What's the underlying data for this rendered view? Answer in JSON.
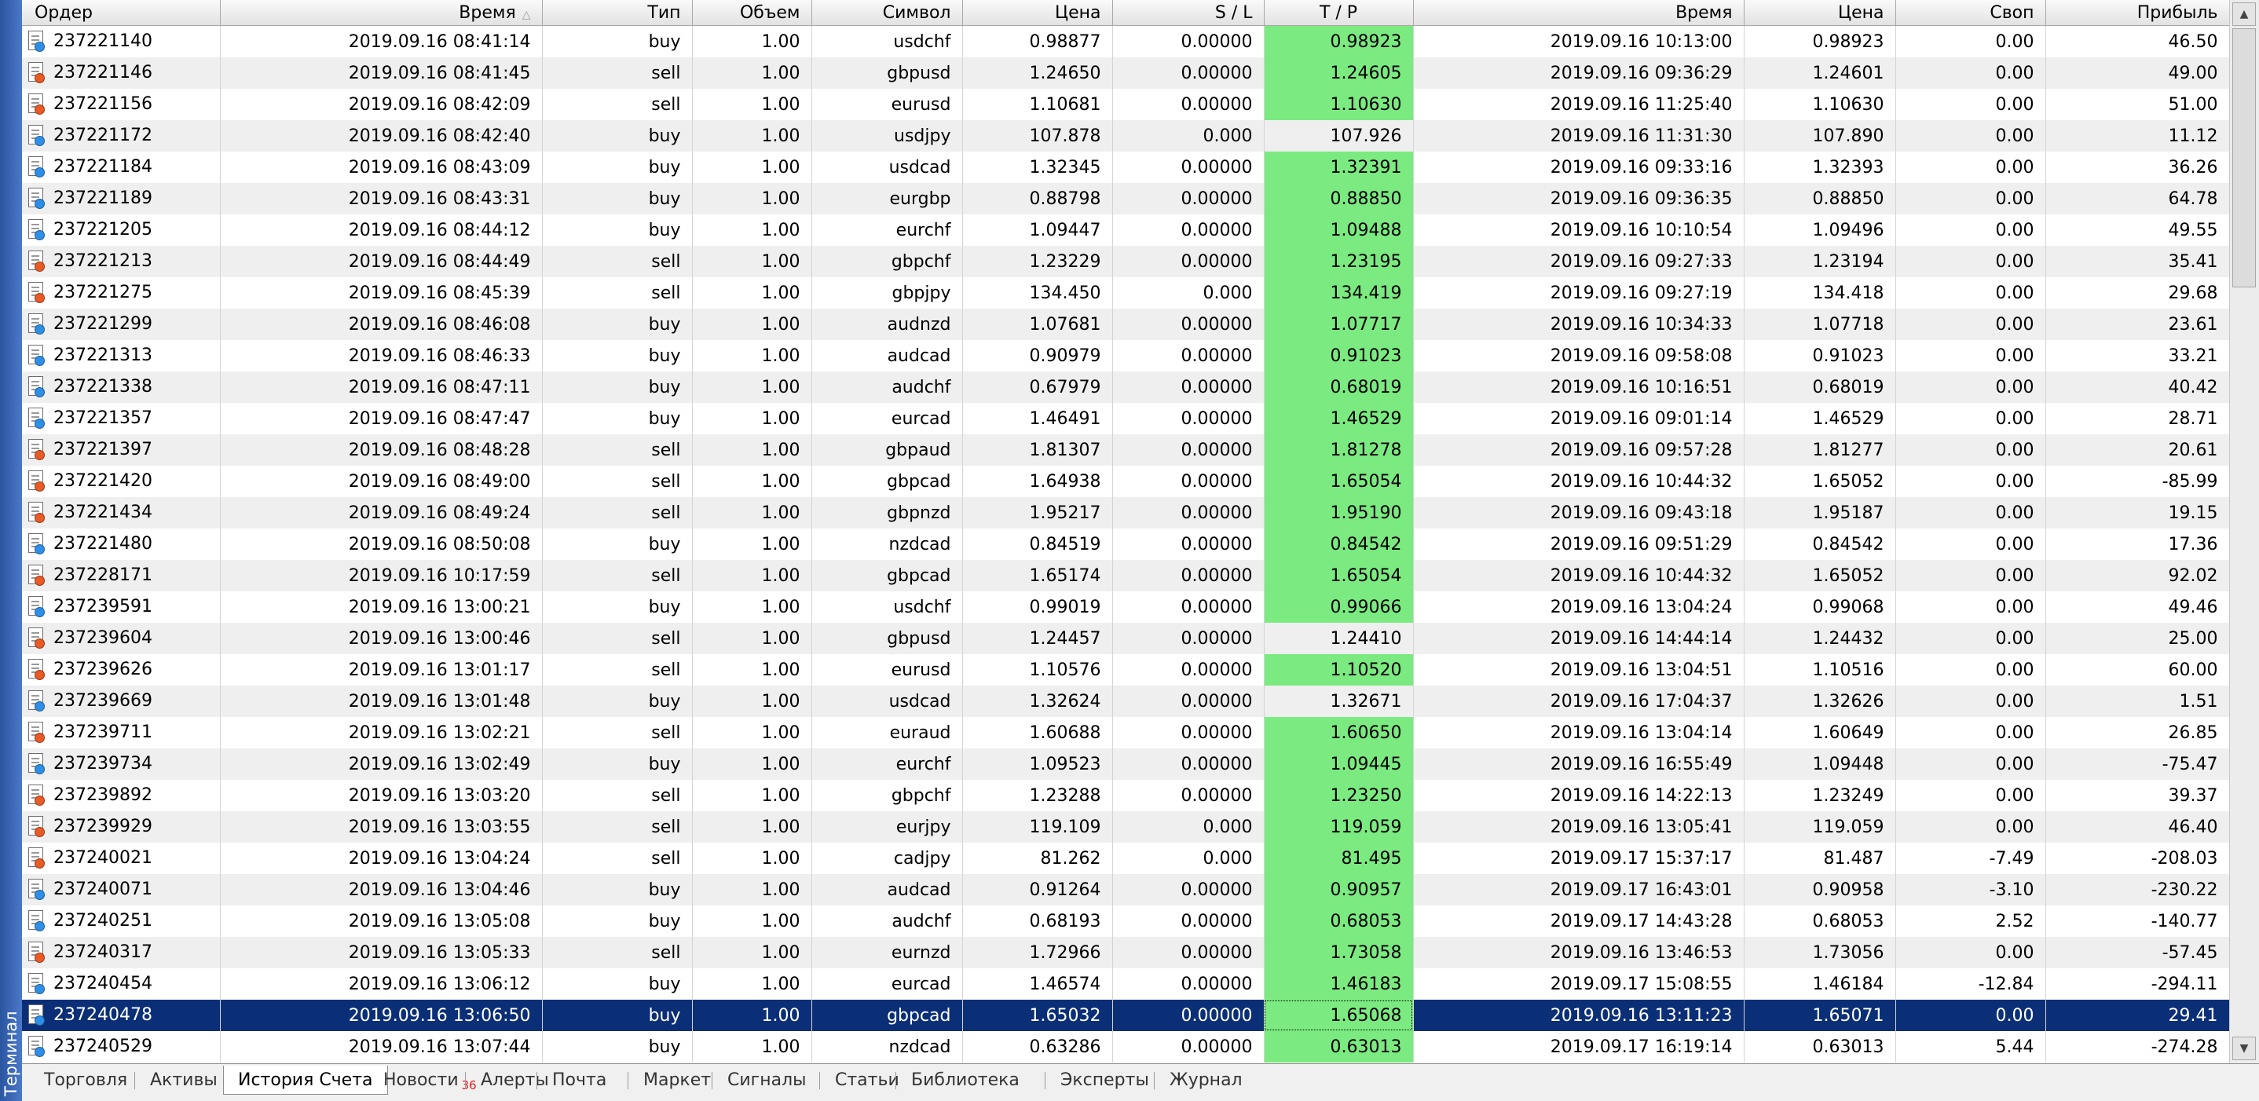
{
  "window": {
    "panel_title": "Терминал"
  },
  "colors": {
    "buy_dot": "#2f8fe6",
    "sell_dot": "#e85a26",
    "tp_hit": "#7bea80",
    "selected_row": "#0b2f77"
  },
  "icons": {
    "order_icon": "document-icon",
    "sort_indicator": "sort-up-triangle-icon"
  },
  "columns": [
    "Ордер",
    "Время",
    "Тип",
    "Объем",
    "Символ",
    "Цена",
    "S / L",
    "T / P",
    "Время",
    "Цена",
    "Своп",
    "Прибыль"
  ],
  "sorted_column": 1,
  "rows": [
    {
      "order": "237221140",
      "time": "2019.09.16 08:41:14",
      "type": "buy",
      "volume": "1.00",
      "symbol": "usdchf",
      "price": "0.98877",
      "sl": "0.00000",
      "tp": "0.98923",
      "close_time": "2019.09.16 10:13:00",
      "close_price": "0.98923",
      "swap": "0.00",
      "profit": "46.50",
      "tp_hit": true
    },
    {
      "order": "237221146",
      "time": "2019.09.16 08:41:45",
      "type": "sell",
      "volume": "1.00",
      "symbol": "gbpusd",
      "price": "1.24650",
      "sl": "0.00000",
      "tp": "1.24605",
      "close_time": "2019.09.16 09:36:29",
      "close_price": "1.24601",
      "swap": "0.00",
      "profit": "49.00",
      "tp_hit": true
    },
    {
      "order": "237221156",
      "time": "2019.09.16 08:42:09",
      "type": "sell",
      "volume": "1.00",
      "symbol": "eurusd",
      "price": "1.10681",
      "sl": "0.00000",
      "tp": "1.10630",
      "close_time": "2019.09.16 11:25:40",
      "close_price": "1.10630",
      "swap": "0.00",
      "profit": "51.00",
      "tp_hit": true
    },
    {
      "order": "237221172",
      "time": "2019.09.16 08:42:40",
      "type": "buy",
      "volume": "1.00",
      "symbol": "usdjpy",
      "price": "107.878",
      "sl": "0.000",
      "tp": "107.926",
      "close_time": "2019.09.16 11:31:30",
      "close_price": "107.890",
      "swap": "0.00",
      "profit": "11.12",
      "tp_hit": false
    },
    {
      "order": "237221184",
      "time": "2019.09.16 08:43:09",
      "type": "buy",
      "volume": "1.00",
      "symbol": "usdcad",
      "price": "1.32345",
      "sl": "0.00000",
      "tp": "1.32391",
      "close_time": "2019.09.16 09:33:16",
      "close_price": "1.32393",
      "swap": "0.00",
      "profit": "36.26",
      "tp_hit": true
    },
    {
      "order": "237221189",
      "time": "2019.09.16 08:43:31",
      "type": "buy",
      "volume": "1.00",
      "symbol": "eurgbp",
      "price": "0.88798",
      "sl": "0.00000",
      "tp": "0.88850",
      "close_time": "2019.09.16 09:36:35",
      "close_price": "0.88850",
      "swap": "0.00",
      "profit": "64.78",
      "tp_hit": true
    },
    {
      "order": "237221205",
      "time": "2019.09.16 08:44:12",
      "type": "buy",
      "volume": "1.00",
      "symbol": "eurchf",
      "price": "1.09447",
      "sl": "0.00000",
      "tp": "1.09488",
      "close_time": "2019.09.16 10:10:54",
      "close_price": "1.09496",
      "swap": "0.00",
      "profit": "49.55",
      "tp_hit": true
    },
    {
      "order": "237221213",
      "time": "2019.09.16 08:44:49",
      "type": "sell",
      "volume": "1.00",
      "symbol": "gbpchf",
      "price": "1.23229",
      "sl": "0.00000",
      "tp": "1.23195",
      "close_time": "2019.09.16 09:27:33",
      "close_price": "1.23194",
      "swap": "0.00",
      "profit": "35.41",
      "tp_hit": true
    },
    {
      "order": "237221275",
      "time": "2019.09.16 08:45:39",
      "type": "sell",
      "volume": "1.00",
      "symbol": "gbpjpy",
      "price": "134.450",
      "sl": "0.000",
      "tp": "134.419",
      "close_time": "2019.09.16 09:27:19",
      "close_price": "134.418",
      "swap": "0.00",
      "profit": "29.68",
      "tp_hit": true
    },
    {
      "order": "237221299",
      "time": "2019.09.16 08:46:08",
      "type": "buy",
      "volume": "1.00",
      "symbol": "audnzd",
      "price": "1.07681",
      "sl": "0.00000",
      "tp": "1.07717",
      "close_time": "2019.09.16 10:34:33",
      "close_price": "1.07718",
      "swap": "0.00",
      "profit": "23.61",
      "tp_hit": true
    },
    {
      "order": "237221313",
      "time": "2019.09.16 08:46:33",
      "type": "buy",
      "volume": "1.00",
      "symbol": "audcad",
      "price": "0.90979",
      "sl": "0.00000",
      "tp": "0.91023",
      "close_time": "2019.09.16 09:58:08",
      "close_price": "0.91023",
      "swap": "0.00",
      "profit": "33.21",
      "tp_hit": true
    },
    {
      "order": "237221338",
      "time": "2019.09.16 08:47:11",
      "type": "buy",
      "volume": "1.00",
      "symbol": "audchf",
      "price": "0.67979",
      "sl": "0.00000",
      "tp": "0.68019",
      "close_time": "2019.09.16 10:16:51",
      "close_price": "0.68019",
      "swap": "0.00",
      "profit": "40.42",
      "tp_hit": true
    },
    {
      "order": "237221357",
      "time": "2019.09.16 08:47:47",
      "type": "buy",
      "volume": "1.00",
      "symbol": "eurcad",
      "price": "1.46491",
      "sl": "0.00000",
      "tp": "1.46529",
      "close_time": "2019.09.16 09:01:14",
      "close_price": "1.46529",
      "swap": "0.00",
      "profit": "28.71",
      "tp_hit": true
    },
    {
      "order": "237221397",
      "time": "2019.09.16 08:48:28",
      "type": "sell",
      "volume": "1.00",
      "symbol": "gbpaud",
      "price": "1.81307",
      "sl": "0.00000",
      "tp": "1.81278",
      "close_time": "2019.09.16 09:57:28",
      "close_price": "1.81277",
      "swap": "0.00",
      "profit": "20.61",
      "tp_hit": true
    },
    {
      "order": "237221420",
      "time": "2019.09.16 08:49:00",
      "type": "sell",
      "volume": "1.00",
      "symbol": "gbpcad",
      "price": "1.64938",
      "sl": "0.00000",
      "tp": "1.65054",
      "close_time": "2019.09.16 10:44:32",
      "close_price": "1.65052",
      "swap": "0.00",
      "profit": "-85.99",
      "tp_hit": true
    },
    {
      "order": "237221434",
      "time": "2019.09.16 08:49:24",
      "type": "sell",
      "volume": "1.00",
      "symbol": "gbpnzd",
      "price": "1.95217",
      "sl": "0.00000",
      "tp": "1.95190",
      "close_time": "2019.09.16 09:43:18",
      "close_price": "1.95187",
      "swap": "0.00",
      "profit": "19.15",
      "tp_hit": true
    },
    {
      "order": "237221480",
      "time": "2019.09.16 08:50:08",
      "type": "buy",
      "volume": "1.00",
      "symbol": "nzdcad",
      "price": "0.84519",
      "sl": "0.00000",
      "tp": "0.84542",
      "close_time": "2019.09.16 09:51:29",
      "close_price": "0.84542",
      "swap": "0.00",
      "profit": "17.36",
      "tp_hit": true
    },
    {
      "order": "237228171",
      "time": "2019.09.16 10:17:59",
      "type": "sell",
      "volume": "1.00",
      "symbol": "gbpcad",
      "price": "1.65174",
      "sl": "0.00000",
      "tp": "1.65054",
      "close_time": "2019.09.16 10:44:32",
      "close_price": "1.65052",
      "swap": "0.00",
      "profit": "92.02",
      "tp_hit": true
    },
    {
      "order": "237239591",
      "time": "2019.09.16 13:00:21",
      "type": "buy",
      "volume": "1.00",
      "symbol": "usdchf",
      "price": "0.99019",
      "sl": "0.00000",
      "tp": "0.99066",
      "close_time": "2019.09.16 13:04:24",
      "close_price": "0.99068",
      "swap": "0.00",
      "profit": "49.46",
      "tp_hit": true
    },
    {
      "order": "237239604",
      "time": "2019.09.16 13:00:46",
      "type": "sell",
      "volume": "1.00",
      "symbol": "gbpusd",
      "price": "1.24457",
      "sl": "0.00000",
      "tp": "1.24410",
      "close_time": "2019.09.16 14:44:14",
      "close_price": "1.24432",
      "swap": "0.00",
      "profit": "25.00",
      "tp_hit": false
    },
    {
      "order": "237239626",
      "time": "2019.09.16 13:01:17",
      "type": "sell",
      "volume": "1.00",
      "symbol": "eurusd",
      "price": "1.10576",
      "sl": "0.00000",
      "tp": "1.10520",
      "close_time": "2019.09.16 13:04:51",
      "close_price": "1.10516",
      "swap": "0.00",
      "profit": "60.00",
      "tp_hit": true
    },
    {
      "order": "237239669",
      "time": "2019.09.16 13:01:48",
      "type": "buy",
      "volume": "1.00",
      "symbol": "usdcad",
      "price": "1.32624",
      "sl": "0.00000",
      "tp": "1.32671",
      "close_time": "2019.09.16 17:04:37",
      "close_price": "1.32626",
      "swap": "0.00",
      "profit": "1.51",
      "tp_hit": false
    },
    {
      "order": "237239711",
      "time": "2019.09.16 13:02:21",
      "type": "sell",
      "volume": "1.00",
      "symbol": "euraud",
      "price": "1.60688",
      "sl": "0.00000",
      "tp": "1.60650",
      "close_time": "2019.09.16 13:04:14",
      "close_price": "1.60649",
      "swap": "0.00",
      "profit": "26.85",
      "tp_hit": true
    },
    {
      "order": "237239734",
      "time": "2019.09.16 13:02:49",
      "type": "buy",
      "volume": "1.00",
      "symbol": "eurchf",
      "price": "1.09523",
      "sl": "0.00000",
      "tp": "1.09445",
      "close_time": "2019.09.16 16:55:49",
      "close_price": "1.09448",
      "swap": "0.00",
      "profit": "-75.47",
      "tp_hit": true
    },
    {
      "order": "237239892",
      "time": "2019.09.16 13:03:20",
      "type": "sell",
      "volume": "1.00",
      "symbol": "gbpchf",
      "price": "1.23288",
      "sl": "0.00000",
      "tp": "1.23250",
      "close_time": "2019.09.16 14:22:13",
      "close_price": "1.23249",
      "swap": "0.00",
      "profit": "39.37",
      "tp_hit": true
    },
    {
      "order": "237239929",
      "time": "2019.09.16 13:03:55",
      "type": "sell",
      "volume": "1.00",
      "symbol": "eurjpy",
      "price": "119.109",
      "sl": "0.000",
      "tp": "119.059",
      "close_time": "2019.09.16 13:05:41",
      "close_price": "119.059",
      "swap": "0.00",
      "profit": "46.40",
      "tp_hit": true
    },
    {
      "order": "237240021",
      "time": "2019.09.16 13:04:24",
      "type": "sell",
      "volume": "1.00",
      "symbol": "cadjpy",
      "price": "81.262",
      "sl": "0.000",
      "tp": "81.495",
      "close_time": "2019.09.17 15:37:17",
      "close_price": "81.487",
      "swap": "-7.49",
      "profit": "-208.03",
      "tp_hit": true
    },
    {
      "order": "237240071",
      "time": "2019.09.16 13:04:46",
      "type": "buy",
      "volume": "1.00",
      "symbol": "audcad",
      "price": "0.91264",
      "sl": "0.00000",
      "tp": "0.90957",
      "close_time": "2019.09.17 16:43:01",
      "close_price": "0.90958",
      "swap": "-3.10",
      "profit": "-230.22",
      "tp_hit": true
    },
    {
      "order": "237240251",
      "time": "2019.09.16 13:05:08",
      "type": "buy",
      "volume": "1.00",
      "symbol": "audchf",
      "price": "0.68193",
      "sl": "0.00000",
      "tp": "0.68053",
      "close_time": "2019.09.17 14:43:28",
      "close_price": "0.68053",
      "swap": "2.52",
      "profit": "-140.77",
      "tp_hit": true
    },
    {
      "order": "237240317",
      "time": "2019.09.16 13:05:33",
      "type": "sell",
      "volume": "1.00",
      "symbol": "eurnzd",
      "price": "1.72966",
      "sl": "0.00000",
      "tp": "1.73058",
      "close_time": "2019.09.16 13:46:53",
      "close_price": "1.73056",
      "swap": "0.00",
      "profit": "-57.45",
      "tp_hit": true
    },
    {
      "order": "237240454",
      "time": "2019.09.16 13:06:12",
      "type": "buy",
      "volume": "1.00",
      "symbol": "eurcad",
      "price": "1.46574",
      "sl": "0.00000",
      "tp": "1.46183",
      "close_time": "2019.09.17 15:08:55",
      "close_price": "1.46184",
      "swap": "-12.84",
      "profit": "-294.11",
      "tp_hit": true
    },
    {
      "order": "237240478",
      "time": "2019.09.16 13:06:50",
      "type": "buy",
      "volume": "1.00",
      "symbol": "gbpcad",
      "price": "1.65032",
      "sl": "0.00000",
      "tp": "1.65068",
      "close_time": "2019.09.16 13:11:23",
      "close_price": "1.65071",
      "swap": "0.00",
      "profit": "29.41",
      "tp_hit": true,
      "selected": true
    },
    {
      "order": "237240529",
      "time": "2019.09.16 13:07:44",
      "type": "buy",
      "volume": "1.00",
      "symbol": "nzdcad",
      "price": "0.63286",
      "sl": "0.00000",
      "tp": "0.63013",
      "close_time": "2019.09.17 16:19:14",
      "close_price": "0.63013",
      "swap": "5.44",
      "profit": "-274.28",
      "tp_hit": true
    }
  ],
  "tabs": [
    {
      "label": "Торговля"
    },
    {
      "label": "Активы"
    },
    {
      "label": "История Счета",
      "active": true
    },
    {
      "label": "Новости",
      "badge": "36"
    },
    {
      "label": "Алерты"
    },
    {
      "label": "Почта"
    },
    {
      "label": "Маркет"
    },
    {
      "label": "Сигналы"
    },
    {
      "label": "Статьи"
    },
    {
      "label": "Библиотека"
    },
    {
      "label": "Эксперты"
    },
    {
      "label": "Журнал"
    }
  ]
}
